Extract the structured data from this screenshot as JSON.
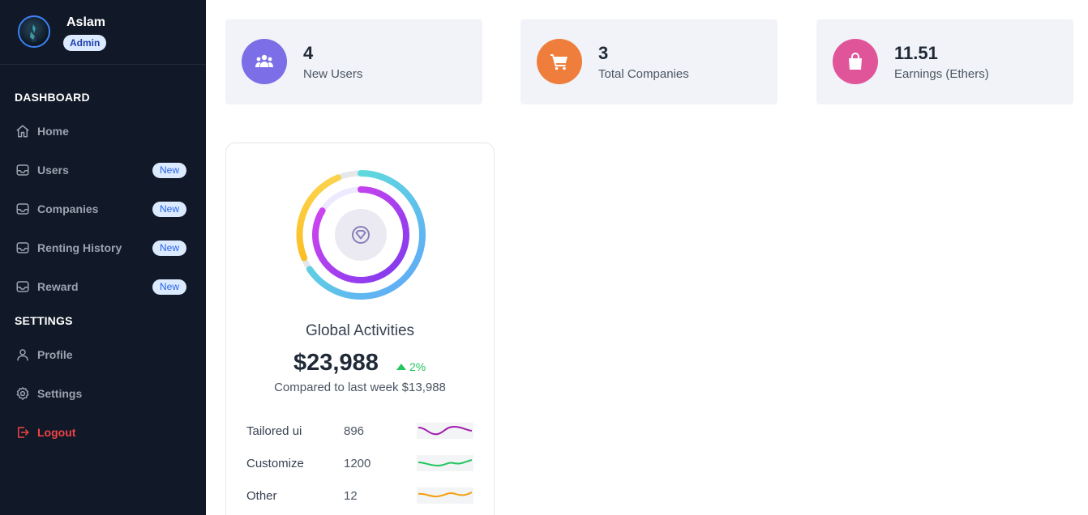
{
  "profile": {
    "name": "Aslam",
    "role": "Admin"
  },
  "sidebar": {
    "dashboard_title": "DASHBOARD",
    "settings_title": "SETTINGS",
    "items": [
      {
        "label": "Home",
        "icon": "home-icon"
      },
      {
        "label": "Users",
        "icon": "inbox-icon",
        "badge": "New"
      },
      {
        "label": "Companies",
        "icon": "inbox-icon",
        "badge": "New"
      },
      {
        "label": "Renting History",
        "icon": "inbox-icon",
        "badge": "New"
      },
      {
        "label": "Reward",
        "icon": "inbox-icon",
        "badge": "New"
      }
    ],
    "settings_items": [
      {
        "label": "Profile",
        "icon": "user-icon"
      },
      {
        "label": "Settings",
        "icon": "gear-icon"
      },
      {
        "label": "Logout",
        "icon": "logout-icon",
        "color": "#ef4444"
      }
    ]
  },
  "stats": [
    {
      "value": "4",
      "label": "New Users",
      "icon": "users-icon",
      "color": "#7c6ee6"
    },
    {
      "value": "3",
      "label": "Total Companies",
      "icon": "cart-icon",
      "color": "#ef7d3c"
    },
    {
      "value": "11.51",
      "label": "Earnings (Ethers)",
      "icon": "shopping-bag-icon",
      "color": "#e0559a"
    }
  ],
  "activity": {
    "title": "Global Activities",
    "amount": "$23,988",
    "trend": "2%",
    "compare": "Compared to last week $13,988",
    "rows": [
      {
        "label": "Tailored ui",
        "value": "896",
        "color": "#a21caf"
      },
      {
        "label": "Customize",
        "value": "1200",
        "color": "#22c55e"
      },
      {
        "label": "Other",
        "value": "12",
        "color": "#f59e0b"
      }
    ]
  }
}
